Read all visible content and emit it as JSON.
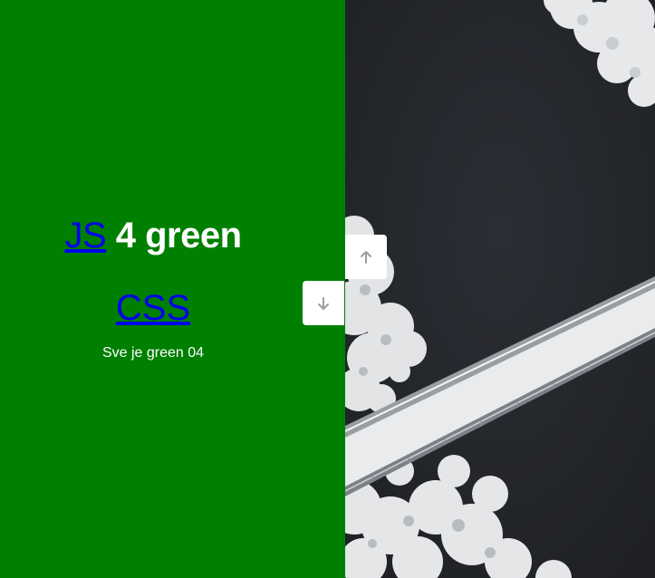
{
  "left_slide": {
    "background_color": "#008000",
    "heading": {
      "link_text": "JS",
      "rest_text": " 4 green"
    },
    "css_link_text": "CSS",
    "subtext": "Sve je green 04"
  },
  "right_slide": {
    "image_subject": "aerial-snowy-bridge-over-dark-water",
    "background_color": "#25272c"
  },
  "controls": {
    "up_icon": "arrow-up-icon",
    "down_icon": "arrow-down-icon",
    "icon_color": "#9e9e9e"
  }
}
